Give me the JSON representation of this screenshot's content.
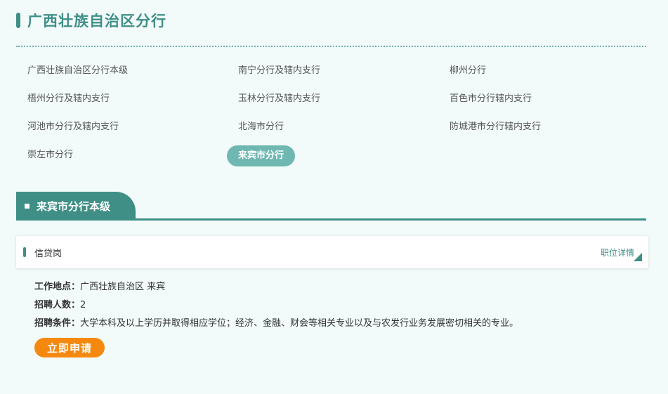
{
  "page": {
    "title": "广西壮族自治区分行"
  },
  "branches": [
    {
      "label": "广西壮族自治区分行本级"
    },
    {
      "label": "南宁分行及辖内支行"
    },
    {
      "label": "柳州分行"
    },
    {
      "label": "梧州分行及辖内支行"
    },
    {
      "label": "玉林分行及辖内支行"
    },
    {
      "label": "百色市分行辖内支行"
    },
    {
      "label": "河池市分行及辖内支行"
    },
    {
      "label": "北海市分行"
    },
    {
      "label": "防城港市分行辖内支行"
    },
    {
      "label": "崇左市分行"
    },
    {
      "label": "来宾市分行"
    }
  ],
  "active_branch": "来宾市分行",
  "section": {
    "title": "来宾市分行本级"
  },
  "job": {
    "name": "信贷岗",
    "detail_label": "职位详情",
    "location_label": "工作地点：",
    "location": "广西壮族自治区 来宾",
    "count_label": "招聘人数：",
    "count": "2",
    "requirement_label": "招聘条件：",
    "requirement": "大学本科及以上学历并取得相应学位；经济、金融、财会等相关专业以及与农发行业务发展密切相关的专业。",
    "apply_label": "立即申请"
  },
  "colors": {
    "primary": "#3f8f86",
    "active_pill": "#6fb8b2",
    "apply": "#f5890f",
    "background": "#f2fafa"
  }
}
